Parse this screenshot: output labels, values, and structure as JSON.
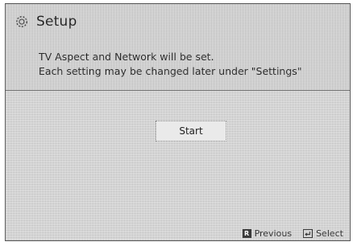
{
  "header": {
    "title": "Setup",
    "icon": "gear-icon"
  },
  "message": {
    "line1": "TV Aspect and Network will be set.",
    "line2": "Each setting may be changed later under \"Settings\""
  },
  "actions": {
    "start_label": "Start"
  },
  "footer": {
    "previous_key": "R",
    "previous_label": "Previous",
    "select_label": "Select"
  },
  "colors": {
    "background": "#c9c9c9",
    "text": "#2a2a2a",
    "button_bg": "#eaeaea"
  }
}
